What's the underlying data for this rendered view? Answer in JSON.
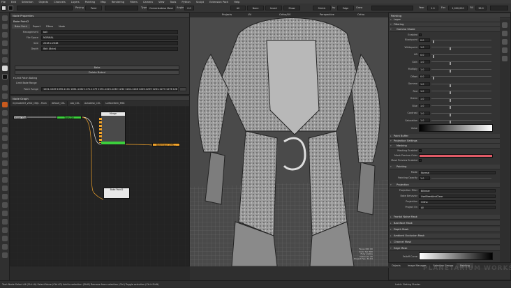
{
  "menu": [
    "File",
    "Edit",
    "Selection",
    "Objects",
    "Channels",
    "Layers",
    "Painting",
    "Map",
    "Rendering",
    "Filters",
    "Camera",
    "View",
    "Tools",
    "Python",
    "Sculpt",
    "Extension Pack",
    "Help"
  ],
  "toolbar": {
    "painting_label": "Paving",
    "paint_mode": "Paint",
    "type_label": "Type",
    "brush_type": "Cornerstatesa Mask",
    "angle_label": "Angle",
    "angle_value": "0.0",
    "all": "All",
    "none": "None",
    "invert": "Invert",
    "show": "Show",
    "shrink": "Shrink",
    "by_label": "by",
    "by_value": "Edge",
    "year_label": "Year",
    "year_value": "1.0",
    "fov_label": "Fov",
    "fov_value": "1,000,000",
    "fill_label": "Fill",
    "fill_value": "36.0",
    "grow_label": "Grow"
  },
  "node_properties": {
    "title": "Node Properties",
    "node_name": "Bake Point2",
    "tabs": [
      "Bake Point",
      "Export",
      "Filters",
      "Node"
    ],
    "fields": [
      {
        "label": "Management",
        "value": "ball"
      },
      {
        "label": "File Space",
        "value": "NORMAL"
      },
      {
        "label": "Size",
        "value": "2048 x 2048"
      },
      {
        "label": "Depth",
        "value": "8bit (Byte)"
      }
    ],
    "bake_button": "Bake",
    "delete_button": "Delete Baked",
    "limit_patch_baking": "Limit Patch Baking",
    "limit_bake_range": "Limit Bake Range",
    "patch_range_label": "Patch Range",
    "patch_range_value": "1001-1049 1055-1101 1061-1162 1171-1179 1191-1223-1230 1232 1241-1246 1249-1259 1261-1273 1276 1281 1282 1285"
  },
  "node_graph": {
    "title": "Node Graph",
    "tabs": [
      "mymodel03_v002_OBJ1 - Mum",
      "default_COL",
      "cob_COL",
      "Autodesk_COL",
      "surfaceItem_MSK"
    ],
    "nodes": [
      {
        "id": "image-node",
        "label": "image Mask"
      },
      {
        "id": "green-node",
        "label": "Tools Dill"
      },
      {
        "id": "merge-node",
        "label": "Merge"
      },
      {
        "id": "orange-node",
        "label": "Bakeinput 1 MS..."
      },
      {
        "id": "bake-node",
        "label": "Bake Point2"
      }
    ]
  },
  "viewport": {
    "tabs": [
      "Projects",
      "UV",
      "Ortho/UV",
      "Perspective",
      "Ortho"
    ],
    "info_lines": [
      "Faces 000 00",
      "Color Sel 300",
      "Fully visible",
      "Instances 40",
      "Project Fps: 30.64"
    ]
  },
  "painting_panel": {
    "title": "Painting",
    "sections": {
      "layer": "Layer",
      "filtering": "Filtering",
      "gamma_shade": "Gamma Shade",
      "enabled": "Enabled",
      "paint_buffer": "Paint Buffer",
      "projection_settings": "Projection Settings",
      "masking": "Masking",
      "masking_enabled": "Masking Enabled",
      "mask_preview_color": "Mask Preview Color",
      "mask_preview_enabled": "Mask Preview Enabled",
      "painting": "Painting",
      "mode_label": "Mode",
      "mode_value": "Normal",
      "opacity_label": "Painting Opacity",
      "opacity_value": "1.0",
      "projection": "Projection",
      "projection_filter_label": "Projection Filter",
      "projection_filter_value": "Bilinear",
      "bake_behavior_label": "Bake Behavior",
      "bake_behavior_value": "UseBleedAndClear",
      "projection_label": "Projection",
      "projection_value": "Ortho",
      "project_on_label": "Project On",
      "project_on_value": "All",
      "frontal_noise_mask": "Frontal Noise Mask",
      "backface_mask": "Backface Mask",
      "depth_mask": "Depth Mask",
      "ambient_occlusion_mask": "Ambient Occlusion Mask",
      "channel_mask": "Channel Mask",
      "edge_mask": "Edge Mask",
      "falloff_curve": "Falloff Curve"
    },
    "gamma_rows": [
      {
        "label": "Blackpoint",
        "value": "0.0",
        "level": 0.02
      },
      {
        "label": "Whitepoint",
        "value": "1.0",
        "level": 0.3
      },
      {
        "label": "Lift",
        "value": "0.0",
        "level": 0.02
      },
      {
        "label": "Gain",
        "value": "1.0",
        "level": 0.3
      },
      {
        "label": "Multiply",
        "value": "1.0",
        "level": 0.3
      },
      {
        "label": "Offset",
        "value": "0.0",
        "level": 0.02
      },
      {
        "label": "Gamma",
        "value": "1.0",
        "level": 0.3
      },
      {
        "label": "Red",
        "value": "1.0",
        "level": 0.3
      },
      {
        "label": "Green",
        "value": "1.0",
        "level": 0.3
      },
      {
        "label": "Blue",
        "value": "1.0",
        "level": 0.3
      },
      {
        "label": "Contrast",
        "value": "1.0",
        "level": 0.3
      },
      {
        "label": "Saturation",
        "value": "1.0",
        "level": 0.3
      }
    ],
    "value_label": "Value",
    "bottom_tabs": [
      "Objects",
      "Image Manager",
      "Selection Groups",
      "Painting"
    ]
  },
  "status": {
    "left": "Tool: Node Select All (Ctrl+A)    Select None (Ctrl+D)    Add to selection (Shift)    Remove from selection (Ctrl)    Toggle selection (Ctrl+Shift)",
    "right": "Latch: Baking Shader"
  },
  "colors": {
    "mask_preview": "#e05a66",
    "accent": "#3f8fd6",
    "node_green": "#3cd03c",
    "node_orange": "#f2a32a"
  },
  "watermark": "PLANETARIUM WORKSHOP"
}
